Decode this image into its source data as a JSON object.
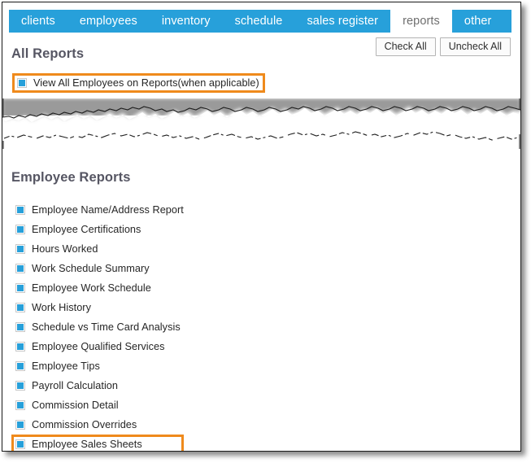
{
  "window": {
    "accent_blue": "#27a0da",
    "highlight_orange": "#ef8a1c",
    "heading_color": "#565663"
  },
  "tabs": [
    {
      "label": "clients",
      "active": false
    },
    {
      "label": "employees",
      "active": false
    },
    {
      "label": "inventory",
      "active": false
    },
    {
      "label": "schedule",
      "active": false
    },
    {
      "label": "sales register",
      "active": false
    },
    {
      "label": "reports",
      "active": true
    },
    {
      "label": "other",
      "active": false
    }
  ],
  "toolbar": {
    "check_all_label": "Check All",
    "uncheck_all_label": "Uncheck All"
  },
  "all_reports": {
    "heading": "All Reports",
    "view_all_option": {
      "label": "View All Employees on Reports(when applicable)",
      "checked": true,
      "highlighted": true
    }
  },
  "employee_reports": {
    "heading": "Employee Reports",
    "items": [
      {
        "label": "Employee Name/Address Report",
        "checked": true,
        "highlighted": false
      },
      {
        "label": "Employee Certifications",
        "checked": true,
        "highlighted": false
      },
      {
        "label": "Hours Worked",
        "checked": true,
        "highlighted": false
      },
      {
        "label": "Work Schedule Summary",
        "checked": true,
        "highlighted": false
      },
      {
        "label": "Employee Work Schedule",
        "checked": true,
        "highlighted": false
      },
      {
        "label": "Work History",
        "checked": true,
        "highlighted": false
      },
      {
        "label": "Schedule vs Time Card Analysis",
        "checked": true,
        "highlighted": false
      },
      {
        "label": "Employee Qualified Services",
        "checked": true,
        "highlighted": false
      },
      {
        "label": "Employee Tips",
        "checked": true,
        "highlighted": false
      },
      {
        "label": "Payroll Calculation",
        "checked": true,
        "highlighted": false
      },
      {
        "label": "Commission Detail",
        "checked": true,
        "highlighted": false
      },
      {
        "label": "Commission Overrides",
        "checked": true,
        "highlighted": false
      },
      {
        "label": "Employee Sales Sheets",
        "checked": true,
        "highlighted": true
      }
    ]
  }
}
